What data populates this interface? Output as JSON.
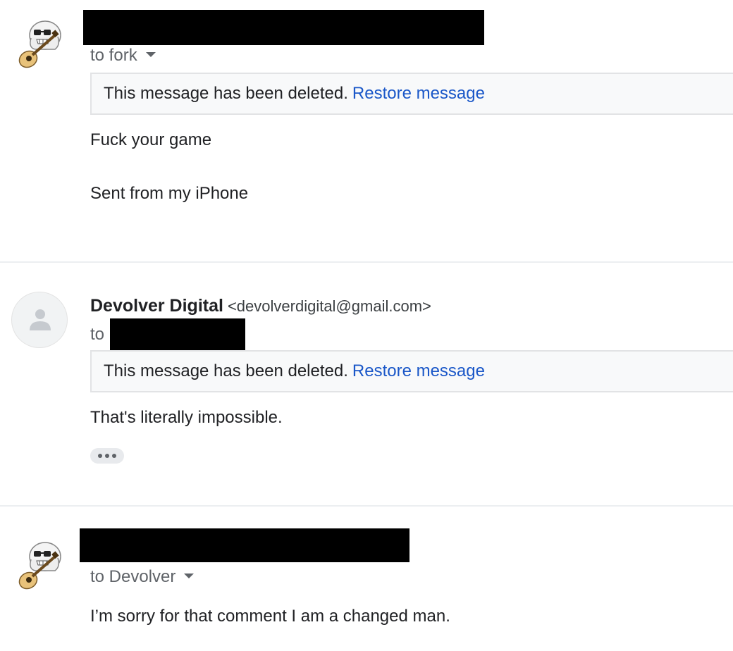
{
  "message1": {
    "to_label": "to fork",
    "deleted_notice": "This message has been deleted.",
    "restore_label": "Restore message",
    "body_line1": "Fuck your game",
    "body_line2": "Sent from my iPhone"
  },
  "message2": {
    "sender_name": "Devolver Digital",
    "sender_email": "<devolverdigital@gmail.com>",
    "to_label": "to",
    "deleted_notice": "This message has been deleted.",
    "restore_label": "Restore message",
    "body_line1": "That's literally impossible."
  },
  "message3": {
    "to_label": "to Devolver",
    "body_line1": "I’m sorry for that comment I am a changed man."
  },
  "colors": {
    "link": "#1a57c8",
    "text": "#202124",
    "muted": "#5f6368"
  },
  "icons": [
    "ghost-guitar-avatar-icon",
    "caret-down-icon",
    "person-icon",
    "more-dots-icon"
  ]
}
